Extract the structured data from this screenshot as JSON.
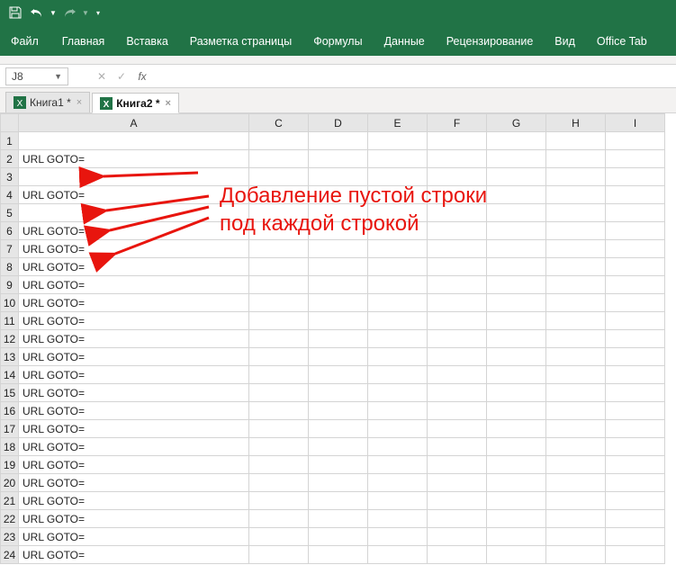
{
  "qat": {
    "save": "save",
    "undo": "undo",
    "redo": "redo"
  },
  "ribbon": {
    "file": "Файл",
    "tabs": [
      "Главная",
      "Вставка",
      "Разметка страницы",
      "Формулы",
      "Данные",
      "Рецензирование",
      "Вид",
      "Office Tab"
    ]
  },
  "formula_bar": {
    "namebox": "J8",
    "cancel": "✕",
    "enter": "✓",
    "fx": "fx",
    "value": ""
  },
  "workbook_tabs": [
    {
      "label": "Книга1 *",
      "active": false
    },
    {
      "label": "Книга2 *",
      "active": true
    }
  ],
  "columns": [
    "A",
    "C",
    "D",
    "E",
    "F",
    "G",
    "H",
    "I"
  ],
  "rows": [
    {
      "n": 1,
      "a": ""
    },
    {
      "n": 2,
      "a": "URL GOTO="
    },
    {
      "n": 3,
      "a": ""
    },
    {
      "n": 4,
      "a": "URL GOTO="
    },
    {
      "n": 5,
      "a": ""
    },
    {
      "n": 6,
      "a": "URL GOTO="
    },
    {
      "n": 7,
      "a": "URL GOTO="
    },
    {
      "n": 8,
      "a": "URL GOTO="
    },
    {
      "n": 9,
      "a": "URL GOTO="
    },
    {
      "n": 10,
      "a": "URL GOTO="
    },
    {
      "n": 11,
      "a": "URL GOTO="
    },
    {
      "n": 12,
      "a": "URL GOTO="
    },
    {
      "n": 13,
      "a": "URL GOTO="
    },
    {
      "n": 14,
      "a": "URL GOTO="
    },
    {
      "n": 15,
      "a": "URL GOTO="
    },
    {
      "n": 16,
      "a": "URL GOTO="
    },
    {
      "n": 17,
      "a": "URL GOTO="
    },
    {
      "n": 18,
      "a": "URL GOTO="
    },
    {
      "n": 19,
      "a": "URL GOTO="
    },
    {
      "n": 20,
      "a": "URL GOTO="
    },
    {
      "n": 21,
      "a": "URL GOTO="
    },
    {
      "n": 22,
      "a": "URL GOTO="
    },
    {
      "n": 23,
      "a": "URL GOTO="
    },
    {
      "n": 24,
      "a": "URL GOTO="
    }
  ],
  "annotation": {
    "line1": "Добавление пустой строки",
    "line2": "под каждой строкой"
  }
}
